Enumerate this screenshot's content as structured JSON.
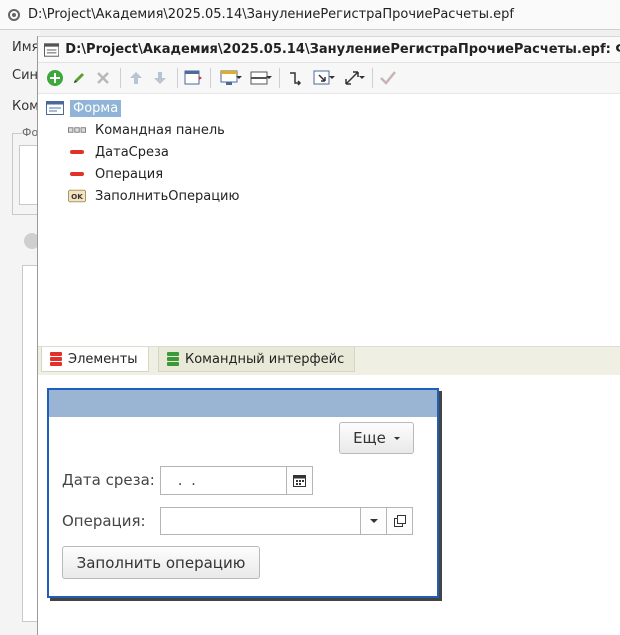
{
  "back_window": {
    "title": "D:\\Project\\Академия\\2025.05.14\\ЗанулениеРегистраПрочиеРасчеты.epf",
    "labels": [
      "Имя",
      "Син",
      "Ком"
    ],
    "group_caption": "Фо"
  },
  "front_window": {
    "title": "D:\\Project\\Академия\\2025.05.14\\ЗанулениеРегистраПрочиеРасчеты.epf: Фор"
  },
  "toolbar": {
    "buttons": [
      "add-icon",
      "edit-icon",
      "delete-icon",
      "move-up-icon",
      "move-down-icon",
      "form-icon",
      "appearance-icon",
      "grouping-icon",
      "swap-icon",
      "select-icon",
      "resize-icon",
      "check-icon"
    ]
  },
  "tree": {
    "root": "Форма",
    "items": [
      "Командная панель",
      "ДатаСреза",
      "Операция",
      "ЗаполнитьОперацию"
    ]
  },
  "tabs": {
    "elements": "Элементы",
    "command_interface": "Командный интерфейс"
  },
  "form_preview": {
    "more_button": "Еще",
    "date_label": "Дата среза:",
    "date_value": "  .  .",
    "operation_label": "Операция:",
    "operation_value": "",
    "fill_button": "Заполнить операцию"
  }
}
